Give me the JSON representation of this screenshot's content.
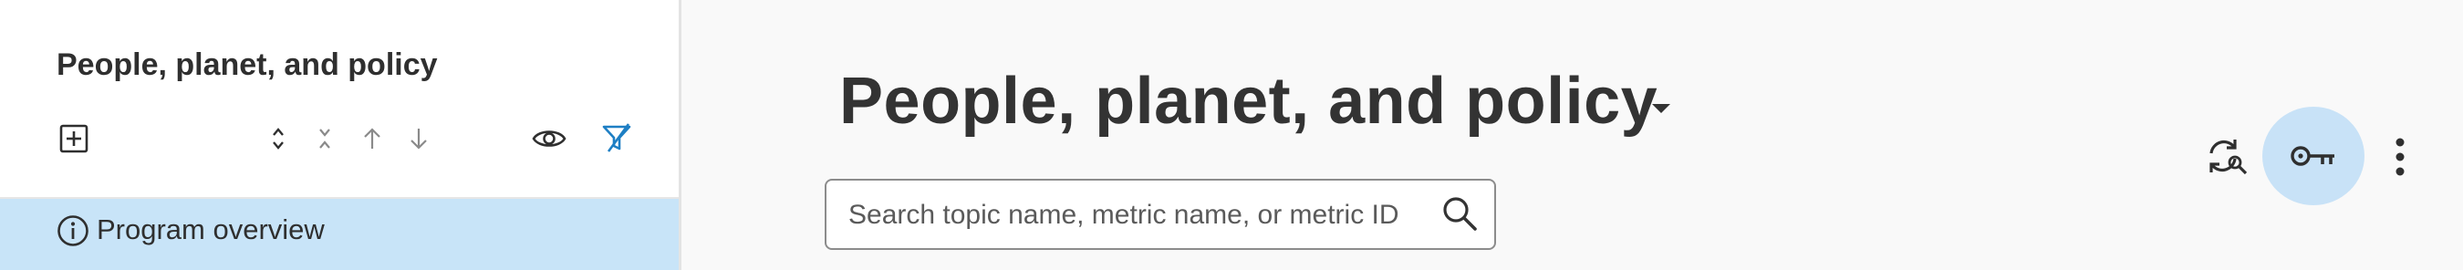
{
  "sidebar": {
    "title": "People, planet, and policy",
    "toolbar": {
      "add_icon": "plus-square-icon",
      "expand_icon": "chevrons-expand-icon",
      "collapse_icon": "chevrons-collapse-icon",
      "move_up_icon": "arrow-up-icon",
      "move_down_icon": "arrow-down-icon",
      "visibility_icon": "eye-icon",
      "filter_icon": "filter-off-icon"
    },
    "items": [
      {
        "label": "Program overview",
        "icon": "info-circle-icon",
        "selected": true
      }
    ]
  },
  "main": {
    "title": "People, planet, and policy",
    "title_dropdown_icon": "caret-down-icon",
    "search": {
      "placeholder": "Search topic name, metric name, or metric ID",
      "value": "",
      "icon": "search-icon"
    },
    "actions": {
      "refresh_icon": "refresh-search-icon",
      "key_icon": "key-icon",
      "more_icon": "kebab-menu-icon"
    }
  },
  "colors": {
    "selected_item_bg": "#c8e4f8",
    "key_button_bg": "#c8e2f7",
    "filter_accent": "#1e7fc4",
    "text_dark": "#333333"
  }
}
